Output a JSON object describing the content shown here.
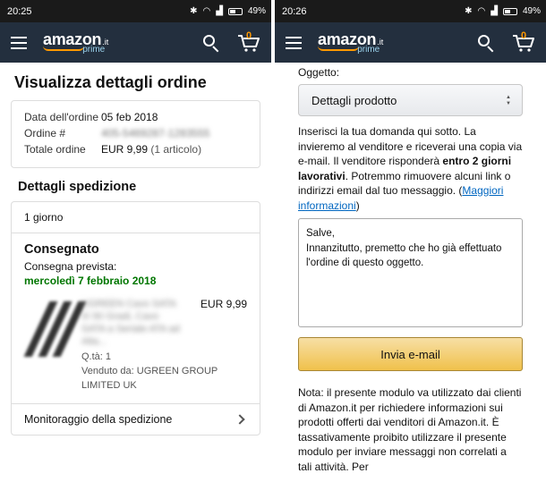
{
  "left": {
    "status_time": "20:25",
    "battery": "49%",
    "page_title": "Visualizza dettagli ordine",
    "order": {
      "date_label": "Data dell'ordine",
      "date_value": "05 feb 2018",
      "number_label": "Ordine #",
      "number_value": "405-5469287-1283555",
      "total_label": "Totale ordine",
      "total_value": "EUR 9,99",
      "total_items": "(1 articolo)"
    },
    "shipping": {
      "section_title": "Dettagli spedizione",
      "speed": "1 giorno",
      "status": "Consegnato",
      "expected_label": "Consegna prevista:",
      "expected_date": "mercoledì 7 febbraio 2018",
      "product_name": "UGREEN Cavo SATA III 90 Gradi, Cavo SATA a Seriale ATA ad Alta...",
      "product_price": "EUR 9,99",
      "quantity": "Q.tà: 1",
      "seller": "Venduto da: UGREEN GROUP LIMITED UK",
      "tracking": "Monitoraggio della spedizione"
    }
  },
  "right": {
    "status_time": "20:26",
    "battery": "49%",
    "subject_label": "Oggetto:",
    "subject_value": "Dettagli prodotto",
    "help_part1": "Inserisci la tua domanda qui sotto. La invieremo al venditore e riceverai una copia via e-mail. Il venditore risponderà ",
    "help_bold": "entro 2 giorni lavorativi",
    "help_part2": ". Potremmo rimuovere alcuni link o indirizzi email dal tuo messaggio. (",
    "help_link": "Maggiori informazioni",
    "help_part3": ")",
    "message_line1": "Salve,",
    "message_line2": "Innanzitutto, premetto che ho già effettuato l'ordine di questo oggetto.",
    "send_label": "Invia e-mail",
    "note": "Nota: il presente modulo va utilizzato dai clienti di Amazon.it per richiedere informazioni sui prodotti offerti dai venditori di Amazon.it. È tassativamente proibito utilizzare il presente modulo per inviare messaggi non correlati a tali attività. Per"
  },
  "brand": {
    "logo_text": "amazon",
    "logo_tld": ".it",
    "logo_prime": "prime",
    "cart_count": "0",
    "header_color": "#232f3e",
    "smile_color": "#ff9900",
    "green": "#007600",
    "link_color": "#0066c0",
    "button_color": "#f0c14b"
  },
  "icons": [
    "menu-icon",
    "search-icon",
    "cart-icon",
    "bluetooth-icon",
    "wifi-icon",
    "signal-icon",
    "battery-icon",
    "chevron-right-icon"
  ]
}
